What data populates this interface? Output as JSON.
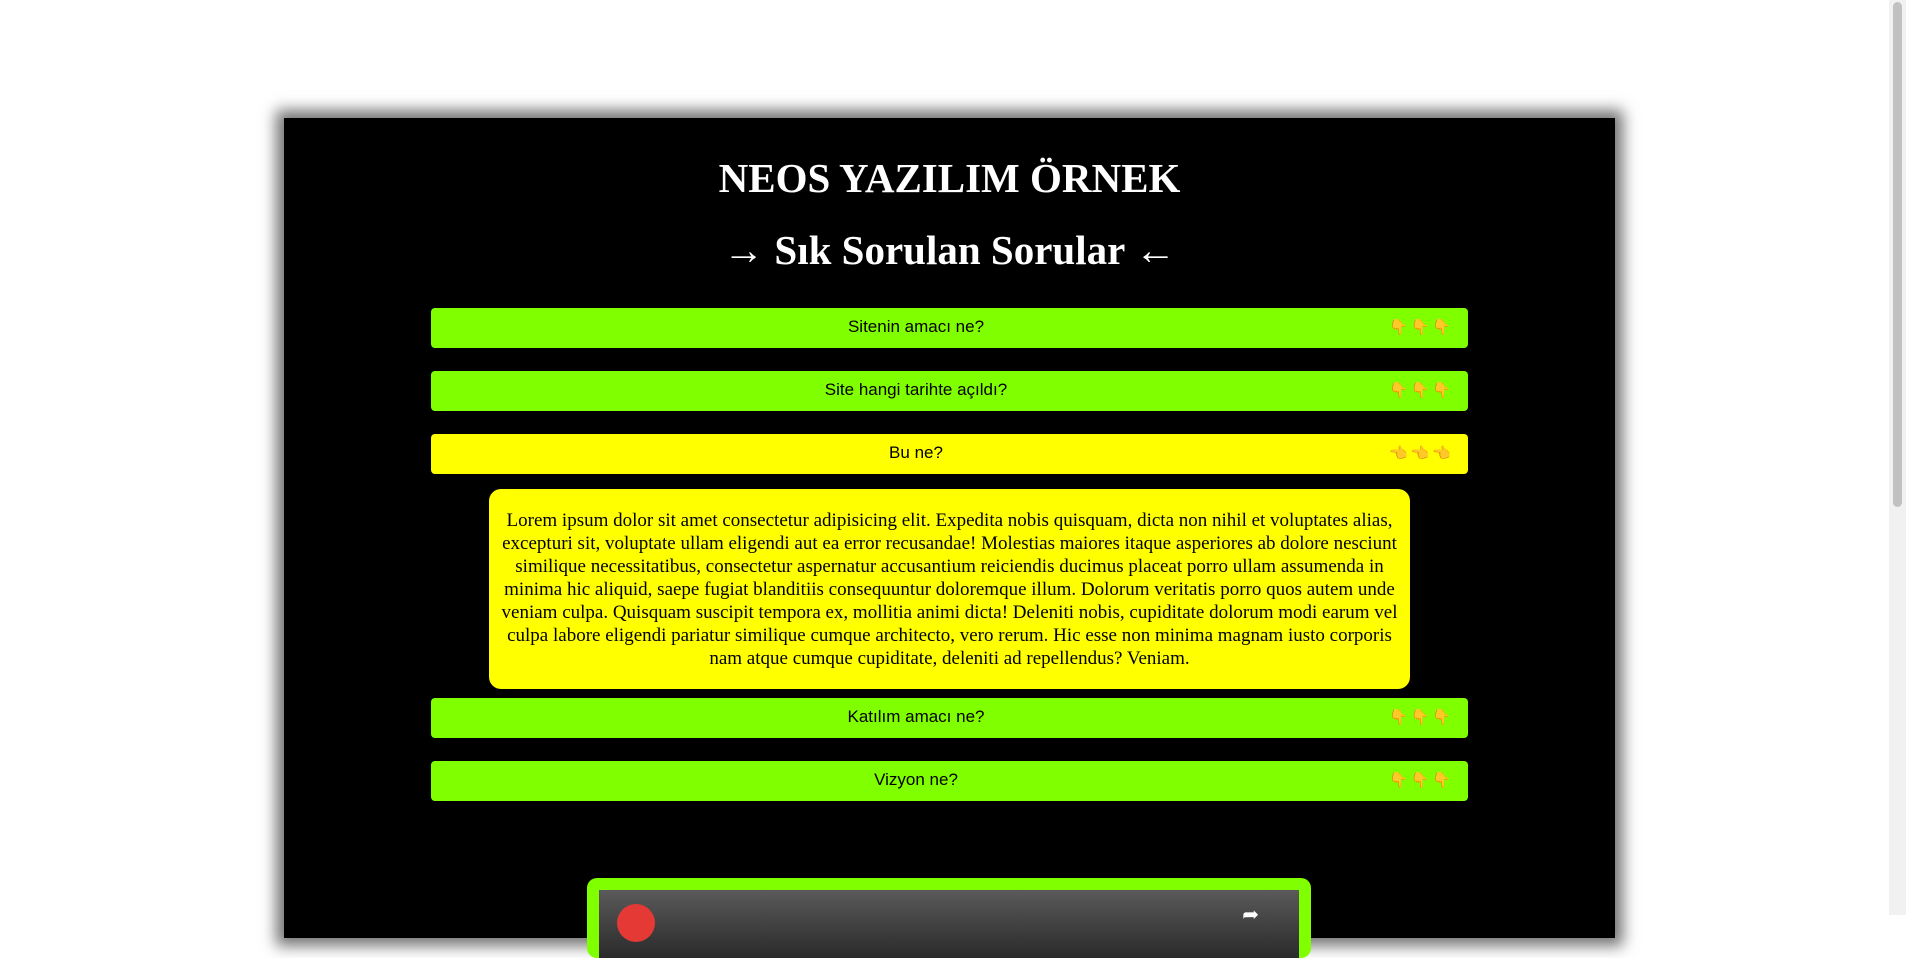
{
  "page": {
    "title": "NEOS YAZILIM ÖRNEK",
    "faq_heading": "→ Sık Sorulan Sorular ←"
  },
  "faq": {
    "items": [
      {
        "question": "Sitenin amacı ne?",
        "icons": "👇👇👇",
        "expanded": false
      },
      {
        "question": "Site hangi tarihte açıldı?",
        "icons": "👇👇👇",
        "expanded": false
      },
      {
        "question": "Bu ne?",
        "icons": "👈👈👈",
        "expanded": true,
        "answer": "Lorem ipsum dolor sit amet consectetur adipisicing elit. Expedita nobis quisquam, dicta non nihil et voluptates alias, excepturi sit, voluptate ullam eligendi aut ea error recusandae! Molestias maiores itaque asperiores ab dolore nesciunt similique necessitatibus, consectetur aspernatur accusantium reiciendis ducimus placeat porro ullam assumenda in minima hic aliquid, saepe fugiat blanditiis consequuntur doloremque illum. Dolorum veritatis porro quos autem unde veniam culpa. Quisquam suscipit tempora ex, mollitia animi dicta! Deleniti nobis, cupiditate dolorum modi earum vel culpa labore eligendi pariatur similique cumque architecto, vero rerum. Hic esse non minima magnam iusto corporis nam atque cumque cupiditate, deleniti ad repellendus? Veniam."
      },
      {
        "question": "Katılım amacı ne?",
        "icons": "👇👇👇",
        "expanded": false
      },
      {
        "question": "Vizyon ne?",
        "icons": "👇👇👇",
        "expanded": false
      }
    ]
  },
  "colors": {
    "panel_bg": "#000000",
    "faq_bar": "#80ff00",
    "faq_bar_open": "#ffff00",
    "video_frame": "#80ff00"
  },
  "video": {
    "logo_icon": "youtube-logo-icon",
    "share_icon": "share-icon"
  }
}
